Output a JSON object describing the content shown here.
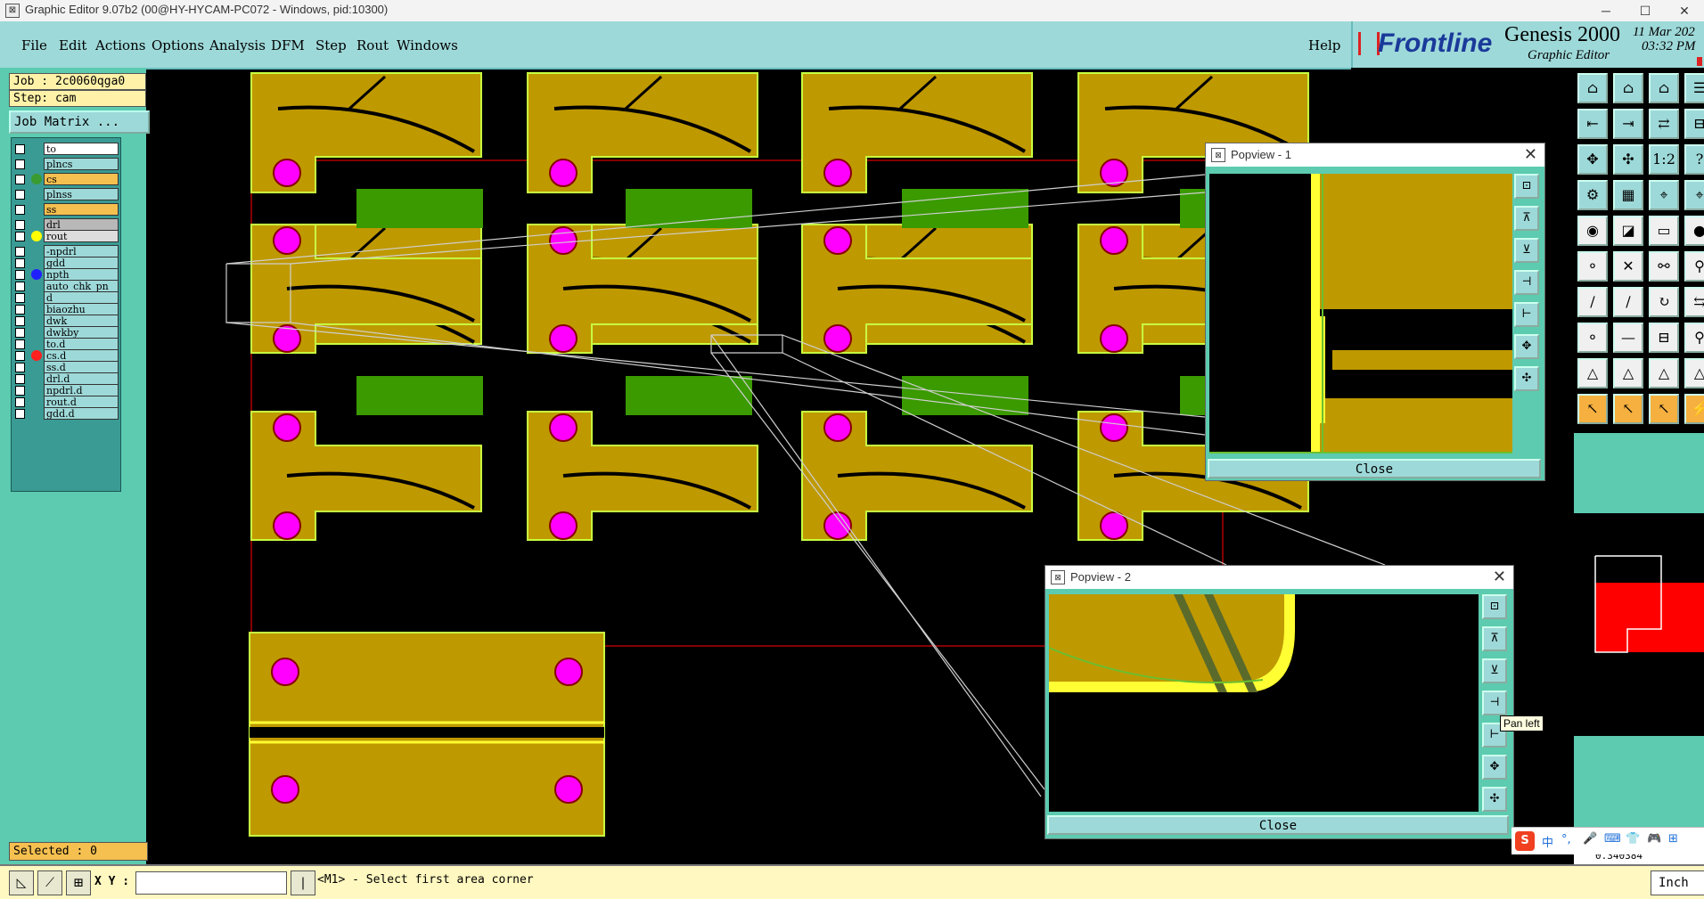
{
  "window": {
    "title": "Graphic Editor 9.07b2 (00@HY-HYCAM-PC072 - Windows, pid:10300)",
    "app_icon": "window-icon",
    "controls": {
      "minimize": "─",
      "maximize": "☐",
      "close": "✕"
    }
  },
  "menu": {
    "items": [
      "File",
      "Edit",
      "Actions",
      "Options",
      "Analysis",
      "DFM",
      "Step",
      "Rout",
      "Windows"
    ],
    "help": "Help"
  },
  "logo": {
    "brand": "Frontline",
    "product": "Genesis 2000",
    "subtitle": "Graphic Editor",
    "date": "11 Mar 202",
    "time": "03:32 PM"
  },
  "job": {
    "job_label": "Job : 2c0060qga0",
    "step_label": "Step: cam",
    "matrix_button": "Job Matrix ..."
  },
  "layers": [
    {
      "name": "to",
      "bg": "#ffffff",
      "dot": ""
    },
    {
      "name": "plncs",
      "bg": "#9ed9d9",
      "dot": ""
    },
    {
      "name": "cs",
      "bg": "#f5c050",
      "dot": "#3a9b30"
    },
    {
      "name": "plnss",
      "bg": "#9ed9d9",
      "dot": ""
    },
    {
      "name": "ss",
      "bg": "#f5c050",
      "dot": ""
    },
    {
      "name": "drl",
      "bg": "#b8b8b8",
      "dot": ""
    },
    {
      "name": "rout",
      "bg": "#dddddd",
      "dot": "#ffff00"
    },
    {
      "name": "-npdrl",
      "bg": "#9ed9d9",
      "dot": ""
    },
    {
      "name": "gdd",
      "bg": "#9ed9d9",
      "dot": ""
    },
    {
      "name": "npth",
      "bg": "#9ed9d9",
      "dot": "#2020ff"
    },
    {
      "name": "auto_chk_pn",
      "bg": "#9ed9d9",
      "dot": ""
    },
    {
      "name": "d",
      "bg": "#9ed9d9",
      "dot": ""
    },
    {
      "name": "biaozhu",
      "bg": "#9ed9d9",
      "dot": ""
    },
    {
      "name": "dwk",
      "bg": "#9ed9d9",
      "dot": ""
    },
    {
      "name": "dwkby",
      "bg": "#9ed9d9",
      "dot": ""
    },
    {
      "name": "to.d",
      "bg": "#9ed9d9",
      "dot": ""
    },
    {
      "name": "cs.d",
      "bg": "#9ed9d9",
      "dot": "#ff2020"
    },
    {
      "name": "ss.d",
      "bg": "#9ed9d9",
      "dot": ""
    },
    {
      "name": "drl.d",
      "bg": "#9ed9d9",
      "dot": ""
    },
    {
      "name": "npdrl.d",
      "bg": "#9ed9d9",
      "dot": ""
    },
    {
      "name": "rout.d",
      "bg": "#9ed9d9",
      "dot": ""
    },
    {
      "name": "gdd.d",
      "bg": "#9ed9d9",
      "dot": ""
    }
  ],
  "selected": "Selected : 0",
  "status": {
    "xy_label": "X Y :",
    "xy_value": "",
    "message": "<M1> - Select first area corner",
    "units": "Inch",
    "coord_partial": "0.340384"
  },
  "popview1": {
    "title": "Popview - 1",
    "close": "Close"
  },
  "popview2": {
    "title": "Popview - 2",
    "close": "Close"
  },
  "tooltip": "Pan left",
  "colors": {
    "copper": "#bf9900",
    "outline": "#c8ff40",
    "pad": "#ff00ff",
    "green": "#3a9a00",
    "panel": "#5ccbb0",
    "menu": "#9ed9d9"
  },
  "ime": {
    "brand": "S",
    "items": [
      "中",
      "°,",
      "🎤",
      "⌨",
      "👕",
      "🎮",
      "⊞"
    ]
  }
}
